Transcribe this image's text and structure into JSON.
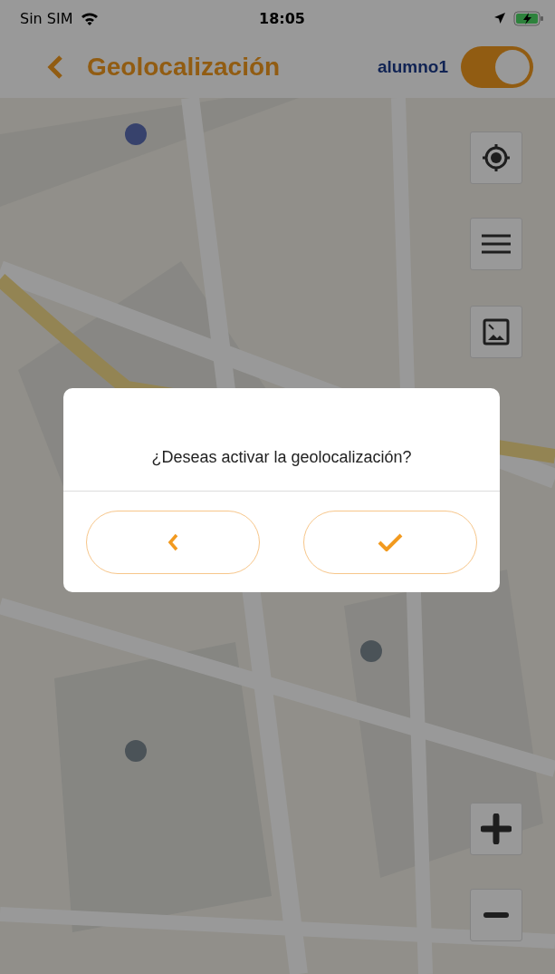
{
  "status_bar": {
    "carrier": "Sin SIM",
    "time": "18:05"
  },
  "header": {
    "title": "Geolocalización",
    "user": "alumno1",
    "toggle": {
      "on": true
    }
  },
  "dialog": {
    "message": "¿Deseas activar la geolocalización?"
  }
}
